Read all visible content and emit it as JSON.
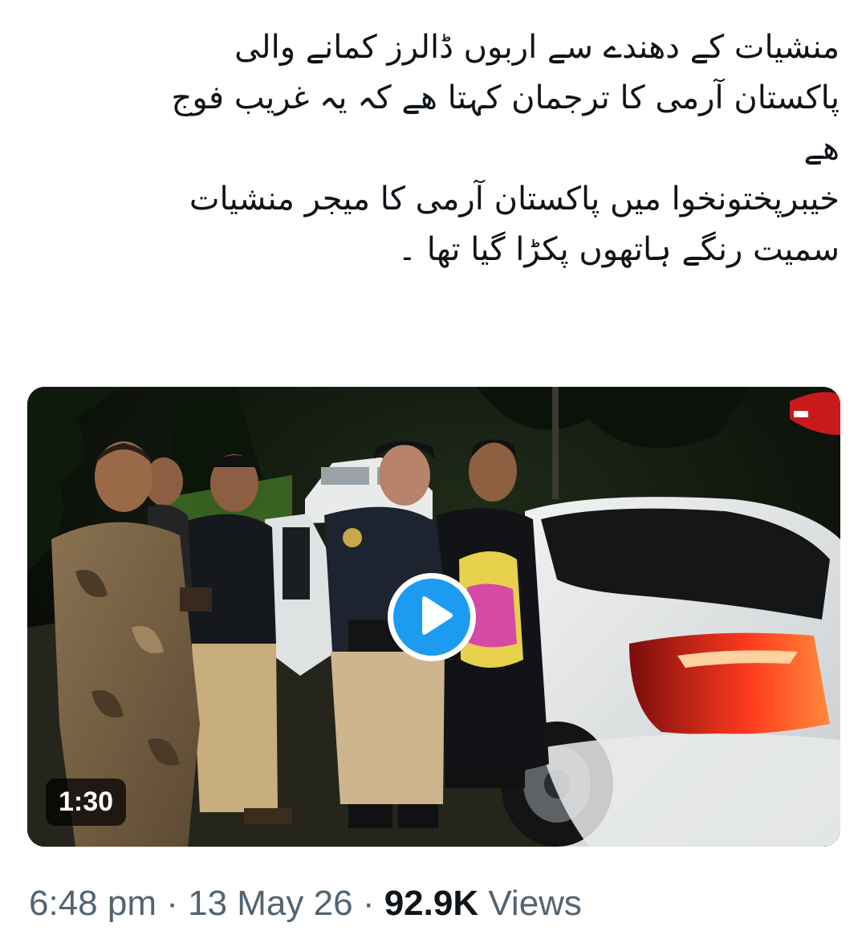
{
  "tweet": {
    "text_lines": [
      "منشیات کے دھندے سے اربوں ڈالرز کمانے والی",
      "پاکستان آرمی کا ترجمان کہتا ھے کہ یہ غریب فوج",
      "ھے",
      "خیبرپختونخوا میں پاکستان آرمی کا میجر منشیات",
      "سمیت رنگے ہاتھوں پکڑا گیا تھا ۔"
    ]
  },
  "media": {
    "type": "video",
    "duration": "1:30",
    "play_icon": "play-icon"
  },
  "meta": {
    "time": "6:48 pm",
    "separator": "·",
    "date": "13 May 26",
    "views_count": "92.9K",
    "views_label": "Views"
  },
  "colors": {
    "text_primary": "#0f1419",
    "text_secondary": "#536471",
    "accent": "#1d9bf0"
  }
}
